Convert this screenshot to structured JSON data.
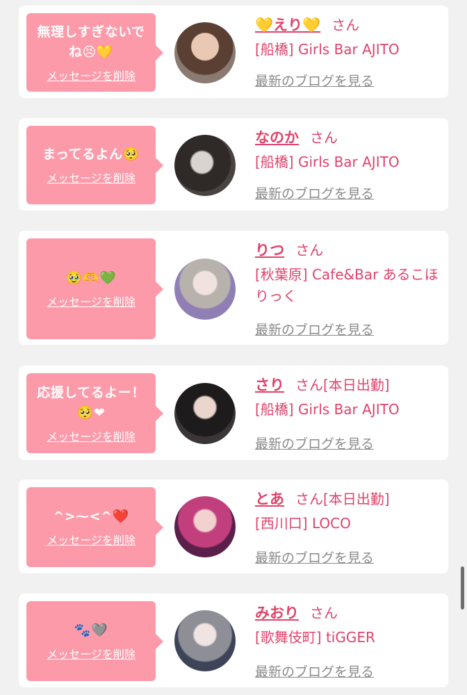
{
  "delete_label": "メッセージを削除",
  "honorific": "さん",
  "blog_label": "最新のブログを見る",
  "colors": {
    "bubble": "#fd9aaa",
    "name": "#e0426a",
    "blog": "#8a8a8a",
    "background": "#f2f1f1"
  },
  "cards": [
    {
      "message": "無理しすぎないでね😣💛",
      "name": "💛えり💛",
      "status": "",
      "shop": "[船橋] Girls Bar AJITO"
    },
    {
      "message": "まってるよん🥺",
      "name": "なのか",
      "status": "",
      "shop": "[船橋] Girls Bar AJITO"
    },
    {
      "message": "🥹🫶💚",
      "name": "りつ",
      "status": "",
      "shop": "[秋葉原] Cafe&Bar あるこほりっく"
    },
    {
      "message": "応援してるよー！🥺❤",
      "name": "さり",
      "status": "[本日出勤]",
      "shop": "[船橋] Girls Bar AJITO"
    },
    {
      "message": "^>⁓<^❤️",
      "name": "とあ",
      "status": "[本日出勤]",
      "shop": "[西川口] LOCO"
    },
    {
      "message": "🐾🩶",
      "name": "みおり",
      "status": "",
      "shop": "[歌舞伎町] tiGGER"
    }
  ]
}
